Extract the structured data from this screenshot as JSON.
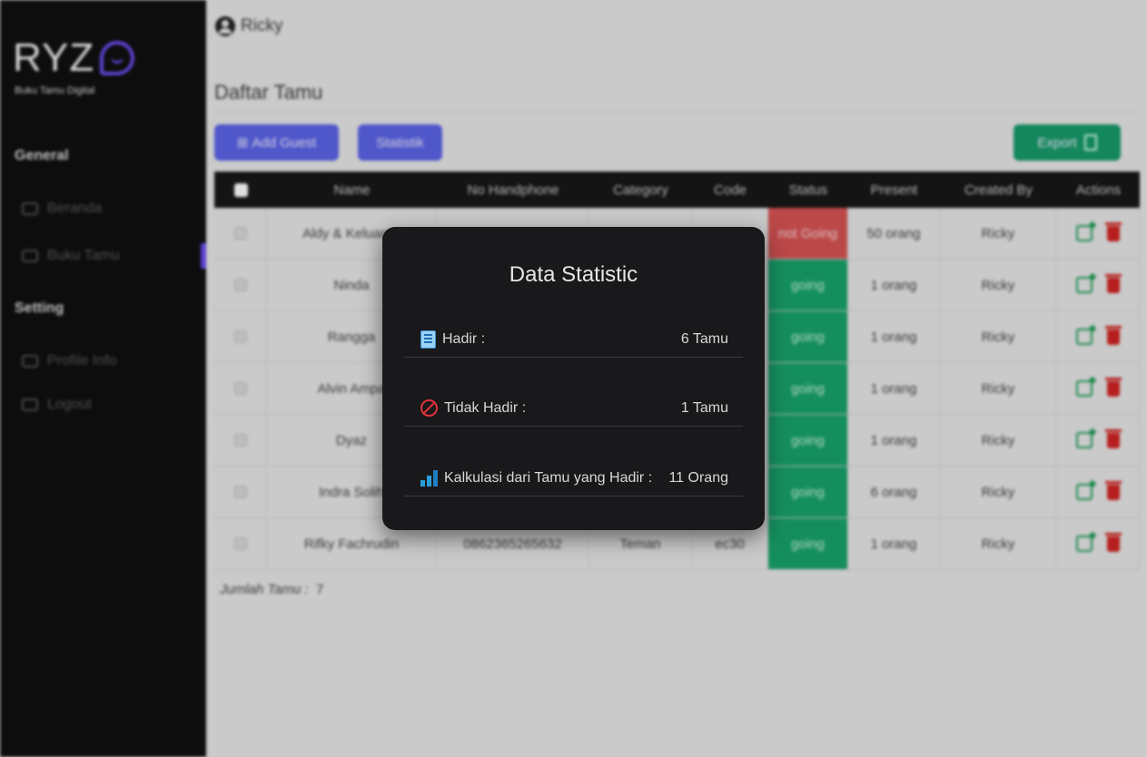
{
  "app": {
    "logo_text": "RYZ",
    "logo_subtitle": "Buku Tamu Digital"
  },
  "sidebar": {
    "sections": [
      {
        "title": "General",
        "items": [
          {
            "label": "Beranda",
            "icon": "home-icon"
          },
          {
            "label": "Buku Tamu",
            "icon": "book-icon"
          }
        ]
      },
      {
        "title": "Setting",
        "items": [
          {
            "label": "Profile Info",
            "icon": "user-icon"
          },
          {
            "label": "Logout",
            "icon": "logout-icon"
          }
        ]
      }
    ]
  },
  "header": {
    "user_name": "Ricky"
  },
  "page": {
    "title": "Daftar Tamu",
    "add_button": "Add Guest",
    "stat_button": "Statistik",
    "export_button": "Export",
    "total_label": "Jumlah Tamu :",
    "total_value": "7"
  },
  "table": {
    "columns": [
      "Name",
      "No Handphone",
      "Category",
      "Code",
      "Status",
      "Present",
      "Created By",
      "Actions"
    ],
    "rows": [
      {
        "name": "Aldy & Keluarga",
        "phone": "",
        "category": "",
        "code": "",
        "status": "not Going",
        "present": "50 orang",
        "created_by": "Ricky"
      },
      {
        "name": "Ninda",
        "phone": "",
        "category": "",
        "code": "",
        "status": "going",
        "present": "1 orang",
        "created_by": "Ricky"
      },
      {
        "name": "Rangga",
        "phone": "",
        "category": "",
        "code": "",
        "status": "going",
        "present": "1 orang",
        "created_by": "Ricky"
      },
      {
        "name": "Alvin Ampa",
        "phone": "",
        "category": "",
        "code": "",
        "status": "going",
        "present": "1 orang",
        "created_by": "Ricky"
      },
      {
        "name": "Dyaz",
        "phone": "",
        "category": "",
        "code": "",
        "status": "going",
        "present": "1 orang",
        "created_by": "Ricky"
      },
      {
        "name": "Indra Solih",
        "phone": "",
        "category": "",
        "code": "",
        "status": "going",
        "present": "6 orang",
        "created_by": "Ricky"
      },
      {
        "name": "Rifky Fachrudin",
        "phone": "0862365265632",
        "category": "Teman",
        "code": "ec30",
        "status": "going",
        "present": "1 orang",
        "created_by": "Ricky"
      }
    ]
  },
  "modal": {
    "title": "Data Statistic",
    "stats": [
      {
        "label": "Hadir :",
        "value": "6 Tamu",
        "icon": "list-icon"
      },
      {
        "label": "Tidak Hadir :",
        "value": "1 Tamu",
        "icon": "prohibited-icon"
      },
      {
        "label": "Kalkulasi dari Tamu yang Hadir :",
        "value": "11 Orang",
        "icon": "bar-chart-icon"
      }
    ]
  },
  "colors": {
    "sidebar_bg": "#0f0f0f",
    "accent": "#6c4cf0",
    "primary_button": "#5b63e6",
    "export_button": "#189a6a",
    "going": "#18a26b",
    "not_going": "#d65353",
    "modal_bg": "#19191b"
  }
}
